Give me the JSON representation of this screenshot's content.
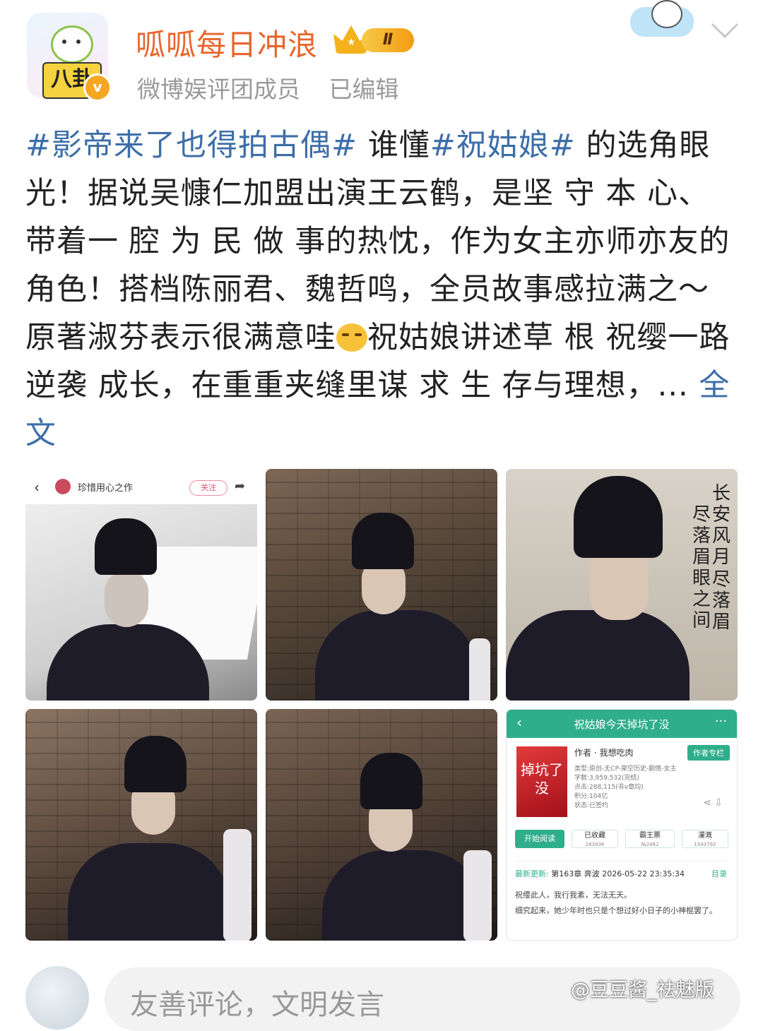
{
  "header": {
    "username": "呱呱每日冲浪",
    "rank_label": "Ⅱ",
    "avatar_label": "八卦",
    "verified_label": "v",
    "subtitle_role": "微博娱评团成员",
    "subtitle_edited": "已编辑"
  },
  "post": {
    "tag1": "#影帝来了也得拍古偶#",
    "text1": " 谁懂",
    "tag2": "#祝姑娘#",
    "text2": " 的选角眼光！据说吴慷仁加盟出演王云鹤，是坚 守 本 心、带着一 腔 为 民 做 事的热忱，作为女主亦师亦友的角色！搭档陈丽君、魏哲鸣，全员故事感拉满之～原著淑芬表示很满意哇",
    "text3": "祝姑娘讲述草 根 祝缨一路 逆袭 成长，在重重夹缝里谋 求 生 存与理想，... ",
    "more_label": "全文"
  },
  "images": {
    "img1": {
      "back": "‹",
      "uname": "珍惜用心之作",
      "follow": "关注",
      "share": "➦"
    },
    "img3": {
      "vert_col1": "长安风月",
      "vert_col1b": "尽落眉",
      "vert_col2": "尽落眉眼之间"
    },
    "img6": {
      "title": "祝姑娘今天掉坑了没",
      "back": "‹",
      "dots": "···",
      "cover_text": "掉坑了没",
      "author": "作者 · 我想吃肉",
      "author_column": "作者专栏",
      "meta": [
        "类型:原创-无CP-架空历史-剧情-女主",
        "字数:3,959,532(完结)",
        "点击:288,115(非v章均)",
        "积分:104亿",
        "状态:已签约"
      ],
      "buttons": {
        "read": "开始阅读",
        "collect": "已收藏",
        "collect_count": "283936",
        "ticket": "霸王票",
        "ticket_count": "№2462",
        "water": "灌溉",
        "water_count": "1543792"
      },
      "update_label": "最新更新:",
      "update_text": "第163章 奔波 2026-05-22 23:35:34",
      "toc": "目录",
      "excerpt1": "祝缨此人，我行我素，无法无天。",
      "excerpt2": "细究起来，她少年时也只是个想过好小日子的小神棍罢了。"
    }
  },
  "comment": {
    "placeholder": "友善评论，文明发言"
  },
  "watermark": "@豆豆酱_祛魅版"
}
